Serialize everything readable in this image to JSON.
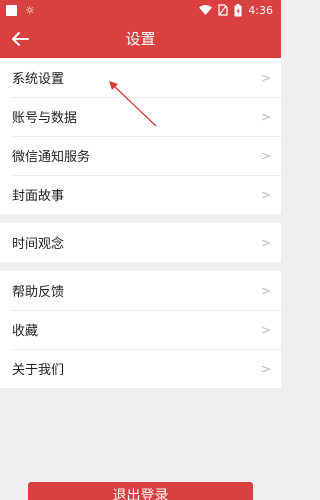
{
  "status_bar": {
    "time": "4:36",
    "icons": [
      "notification-square-icon",
      "brightness-icon",
      "wifi-icon",
      "no-sim-icon",
      "battery-icon"
    ]
  },
  "app_bar": {
    "title": "设置",
    "back_icon": "back-arrow-icon"
  },
  "menu": {
    "group1": [
      {
        "label": "系统设置"
      },
      {
        "label": "账号与数据"
      },
      {
        "label": "微信通知服务"
      },
      {
        "label": "封面故事"
      }
    ],
    "group2": [
      {
        "label": "时间观念"
      }
    ],
    "group3": [
      {
        "label": "帮助反馈"
      },
      {
        "label": "收藏"
      },
      {
        "label": "关于我们"
      }
    ]
  },
  "logout_label": "退出登录",
  "colors": {
    "accent": "#d94040",
    "background": "#efefef",
    "text": "#222222",
    "chevron": "#b8b8b8"
  }
}
